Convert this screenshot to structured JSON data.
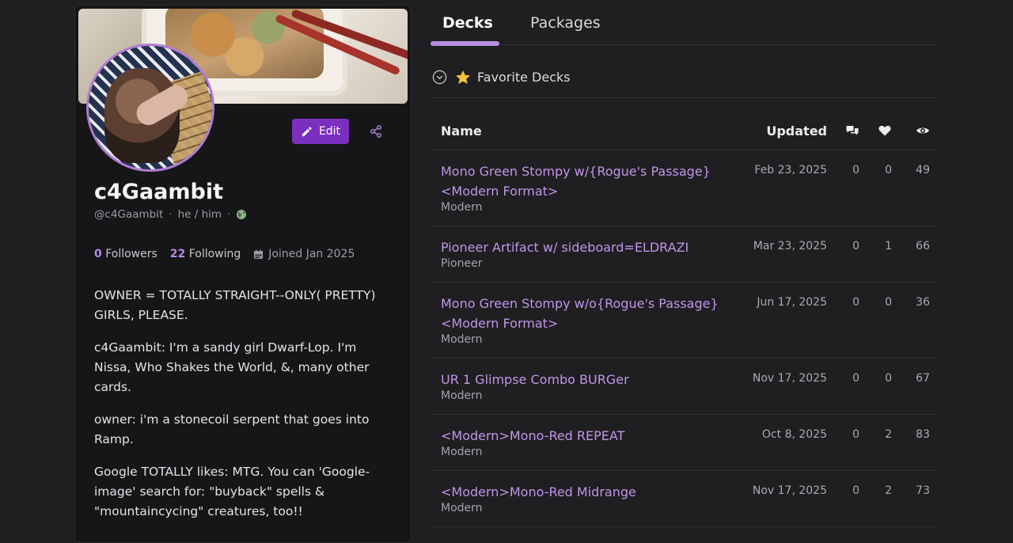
{
  "profile": {
    "display_name": "c4Gaambit",
    "handle": "@c4Gaambit",
    "pronouns": "he / him",
    "edit_label": "Edit",
    "followers_count": "0",
    "followers_label": "Followers",
    "following_count": "22",
    "following_label": "Following",
    "joined": "Joined Jan 2025",
    "bio": [
      "OWNER = TOTALLY STRAIGHT--ONLY( PRETTY) GIRLS, PLEASE.",
      "c4Gaambit: I'm a sandy girl Dwarf-Lop. I'm Nissa, Who Shakes the World, &, many other cards.",
      "owner: i'm a stonecoil serpent that goes into Ramp.",
      "Google TOTALLY likes: MTG. You can 'Google-image' search for: \"buyback\" spells & \"mountaincycing\" creatures, too!!"
    ],
    "accent_color": "#7b2fbf"
  },
  "tabs": [
    {
      "label": "Decks",
      "active": true
    },
    {
      "label": "Packages",
      "active": false
    }
  ],
  "favorites": {
    "label": "Favorite Decks",
    "icon": "star-icon"
  },
  "table": {
    "columns": {
      "name": "Name",
      "updated": "Updated",
      "comments_icon": "comments-icon",
      "likes_icon": "heart-icon",
      "views_icon": "eye-icon"
    },
    "rows": [
      {
        "name": "Mono Green Stompy w/{Rogue's Passage} <Modern Format>",
        "format": "Modern",
        "updated": "Feb 23, 2025",
        "comments": "0",
        "likes": "0",
        "views": "49"
      },
      {
        "name": "Pioneer Artifact w/ sideboard=ELDRAZI",
        "format": "Pioneer",
        "updated": "Mar 23, 2025",
        "comments": "0",
        "likes": "1",
        "views": "66"
      },
      {
        "name": "Mono Green Stompy w/o{Rogue's Passage} <Modern Format>",
        "format": "Modern",
        "updated": "Jun 17, 2025",
        "comments": "0",
        "likes": "0",
        "views": "36"
      },
      {
        "name": "UR 1 Glimpse Combo BURGer",
        "format": "Modern",
        "updated": "Nov 17, 2025",
        "comments": "0",
        "likes": "0",
        "views": "67"
      },
      {
        "name": "<Modern>Mono-Red REPEAT",
        "format": "Modern",
        "updated": "Oct 8, 2025",
        "comments": "0",
        "likes": "2",
        "views": "83"
      },
      {
        "name": "<Modern>Mono-Red Midrange",
        "format": "Modern",
        "updated": "Nov 17, 2025",
        "comments": "0",
        "likes": "2",
        "views": "73"
      }
    ]
  }
}
